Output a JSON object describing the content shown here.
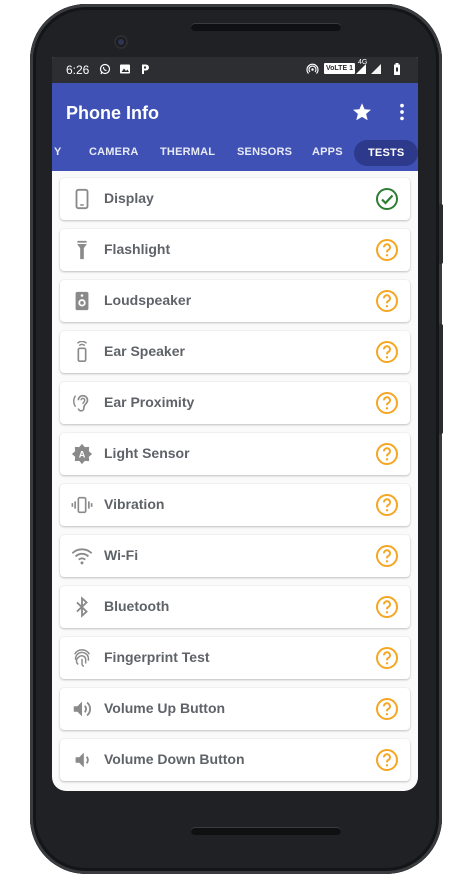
{
  "status_bar": {
    "time": "6:26",
    "network_badge": "VoLTE 1",
    "signal_label": "4G",
    "left_icons": [
      "whatsapp-icon",
      "image-icon",
      "p-icon"
    ],
    "right_icons": [
      "hotspot-icon",
      "volte-icon",
      "signal-icon",
      "signal-icon",
      "battery-icon"
    ]
  },
  "app_bar": {
    "title": "Phone Info",
    "actions": [
      "star-icon",
      "more-vert-icon"
    ]
  },
  "tabs": [
    {
      "label": "Y",
      "active": false
    },
    {
      "label": "CAMERA",
      "active": false
    },
    {
      "label": "THERMAL",
      "active": false
    },
    {
      "label": "SENSORS",
      "active": false
    },
    {
      "label": "APPS",
      "active": false
    },
    {
      "label": "TESTS",
      "active": true
    }
  ],
  "tests": [
    {
      "label": "Display",
      "icon": "phone-icon",
      "status": "passed"
    },
    {
      "label": "Flashlight",
      "icon": "flashlight-icon",
      "status": "unknown"
    },
    {
      "label": "Loudspeaker",
      "icon": "speaker-icon",
      "status": "unknown"
    },
    {
      "label": "Ear Speaker",
      "icon": "ear-speaker-icon",
      "status": "unknown"
    },
    {
      "label": "Ear Proximity",
      "icon": "ear-icon",
      "status": "unknown"
    },
    {
      "label": "Light Sensor",
      "icon": "brightness-auto-icon",
      "status": "unknown"
    },
    {
      "label": "Vibration",
      "icon": "vibration-icon",
      "status": "unknown"
    },
    {
      "label": "Wi-Fi",
      "icon": "wifi-icon",
      "status": "unknown"
    },
    {
      "label": "Bluetooth",
      "icon": "bluetooth-icon",
      "status": "unknown"
    },
    {
      "label": "Fingerprint Test",
      "icon": "fingerprint-icon",
      "status": "unknown"
    },
    {
      "label": "Volume Up Button",
      "icon": "volume-up-icon",
      "status": "unknown"
    },
    {
      "label": "Volume Down Button",
      "icon": "volume-down-icon",
      "status": "unknown"
    }
  ],
  "colors": {
    "app_bar": "#3f51b5",
    "active_tab": "#2d3a8c",
    "passed": "#2e7d32",
    "unknown": "#f5a623",
    "item_text": "#5f6368",
    "icon": "#8a8a8a"
  }
}
